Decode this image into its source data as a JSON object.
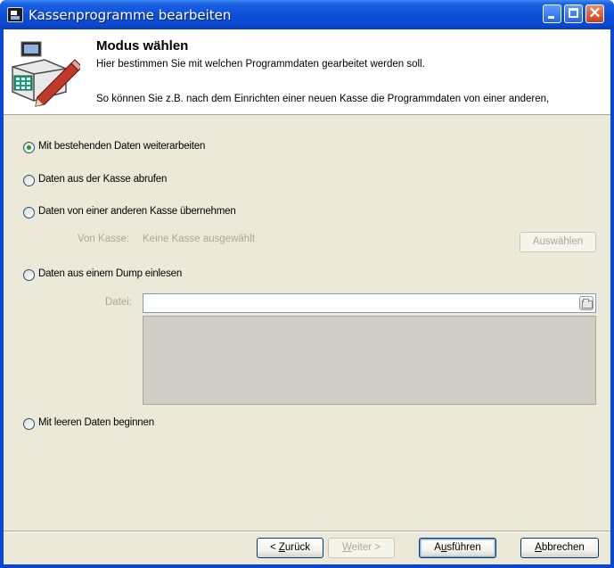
{
  "window": {
    "title": "Kassenprogramme bearbeiten",
    "icon": "app-icon",
    "controls": [
      "minimize-icon",
      "maximize-icon",
      "close-icon"
    ]
  },
  "header": {
    "title": "Modus wählen",
    "line1": "Hier bestimmen Sie mit welchen Programmdaten gearbeitet werden soll.",
    "line2": "So können Sie z.B. nach dem Einrichten einer neuen Kasse die Programmdaten von einer anderen,",
    "illustration": "cash-register-edit-icon"
  },
  "options": {
    "existing": {
      "label": "Mit bestehenden Daten weiterarbeiten",
      "checked": true
    },
    "fetch": {
      "label": "Daten aus der Kasse abrufen",
      "checked": false
    },
    "copy": {
      "label": "Daten von einer anderen Kasse übernehmen",
      "checked": false
    },
    "dump": {
      "label": "Daten aus einem Dump einlesen",
      "checked": false
    },
    "empty": {
      "label": "Mit leeren Daten beginnen",
      "checked": false
    }
  },
  "copy_source": {
    "label": "Von Kasse:",
    "value": "Keine Kasse ausgewählt",
    "select_button": "Auswählen"
  },
  "dump_file": {
    "label": "Datei:",
    "value": "",
    "browse_icon": "folder-open-icon"
  },
  "buttons": {
    "back": {
      "prefix": "< ",
      "accel": "Z",
      "rest": "urück"
    },
    "next": {
      "accel": "W",
      "rest": "eiter >"
    },
    "run": {
      "pre": "A",
      "accel": "u",
      "rest": "sführen"
    },
    "cancel": {
      "accel": "A",
      "rest": "bbrechen"
    }
  },
  "colors": {
    "title_bar": "#0a48cf",
    "dialog_bg": "#ece9d8",
    "radio_dot": "#21a121",
    "disabled_text": "#aca899"
  }
}
